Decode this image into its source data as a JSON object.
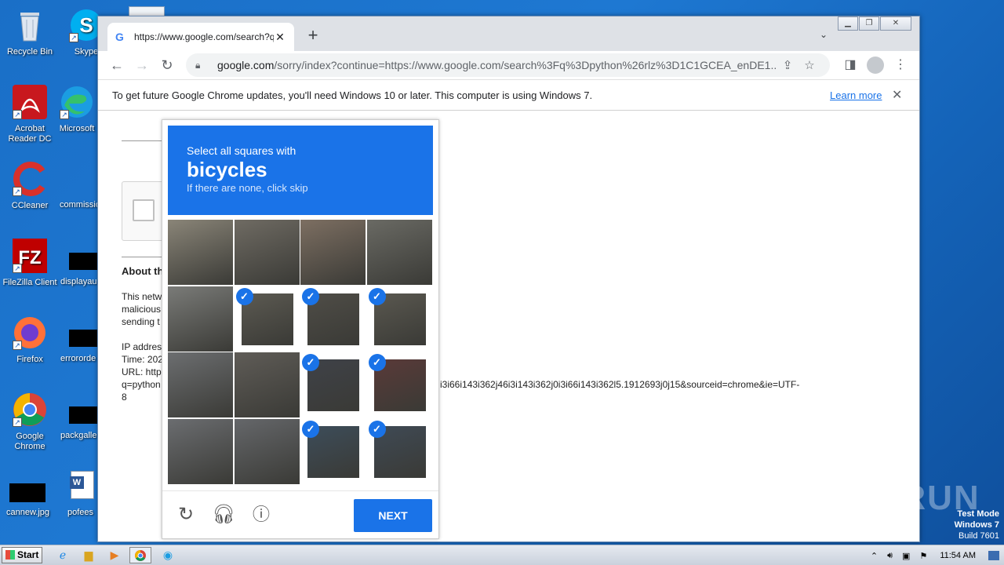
{
  "desktop": {
    "icons": [
      {
        "label": "Recycle Bin"
      },
      {
        "label": "Skype"
      },
      {
        "label": "Acrobat Reader DC"
      },
      {
        "label": "Microsoft"
      },
      {
        "label": "CCleaner"
      },
      {
        "label": "commissio"
      },
      {
        "label": "FileZilla Client"
      },
      {
        "label": "displayau"
      },
      {
        "label": "Firefox"
      },
      {
        "label": "errororde"
      },
      {
        "label": "Google Chrome"
      },
      {
        "label": "packgalle"
      },
      {
        "label": "cannew.jpg"
      },
      {
        "label": "pofees"
      }
    ]
  },
  "browser": {
    "tab_title": "https://www.google.com/search?q=",
    "address_domain": "google.com",
    "address_path": "/sorry/index?continue=https://www.google.com/search%3Fq%3Dpython%26rlz%3D1C1GCEA_enDE1...",
    "infobar_text": "To get future Google Chrome updates, you'll need Windows 10 or later. This computer is using Windows 7.",
    "infobar_link": "Learn more"
  },
  "page": {
    "about_heading": "About th",
    "para_line1": "This netw",
    "para_line2": "malicious",
    "para_line3": "sending t",
    "ip_label": "IP addres",
    "time_label": "Time: 202",
    "url_label": "URL: http",
    "url_line2": "q=python",
    "url_tail": "i3i66i143i362j46i3i143i362j0i3i66i143i362l5.1912693j0j15&sourceid=chrome&ie=UTF-",
    "url_line3": "8"
  },
  "captcha": {
    "line1": "Select all squares with",
    "line2": "bicycles",
    "line3": "If there are none, click skip",
    "next_label": "NEXT",
    "selected": [
      5,
      6,
      7,
      10,
      11,
      14,
      15
    ],
    "tiles": [
      "#8a8578",
      "#6f6b63",
      "#7d6f62",
      "#6a6a64",
      "#7a7b78",
      "#5c5a52",
      "#4f4d47",
      "#5a5850",
      "#6c6e70",
      "#5f5c57",
      "#3f4248",
      "#5a3a38",
      "#6b6d70",
      "#65676a",
      "#3d4d5a",
      "#3f4a55"
    ]
  },
  "taskbar": {
    "start_label": "Start",
    "time": "11:54 AM"
  },
  "overlay": {
    "watermark": "ANY RUN",
    "testmode": "Test Mode",
    "os": "Windows 7",
    "build": "Build 7601"
  }
}
